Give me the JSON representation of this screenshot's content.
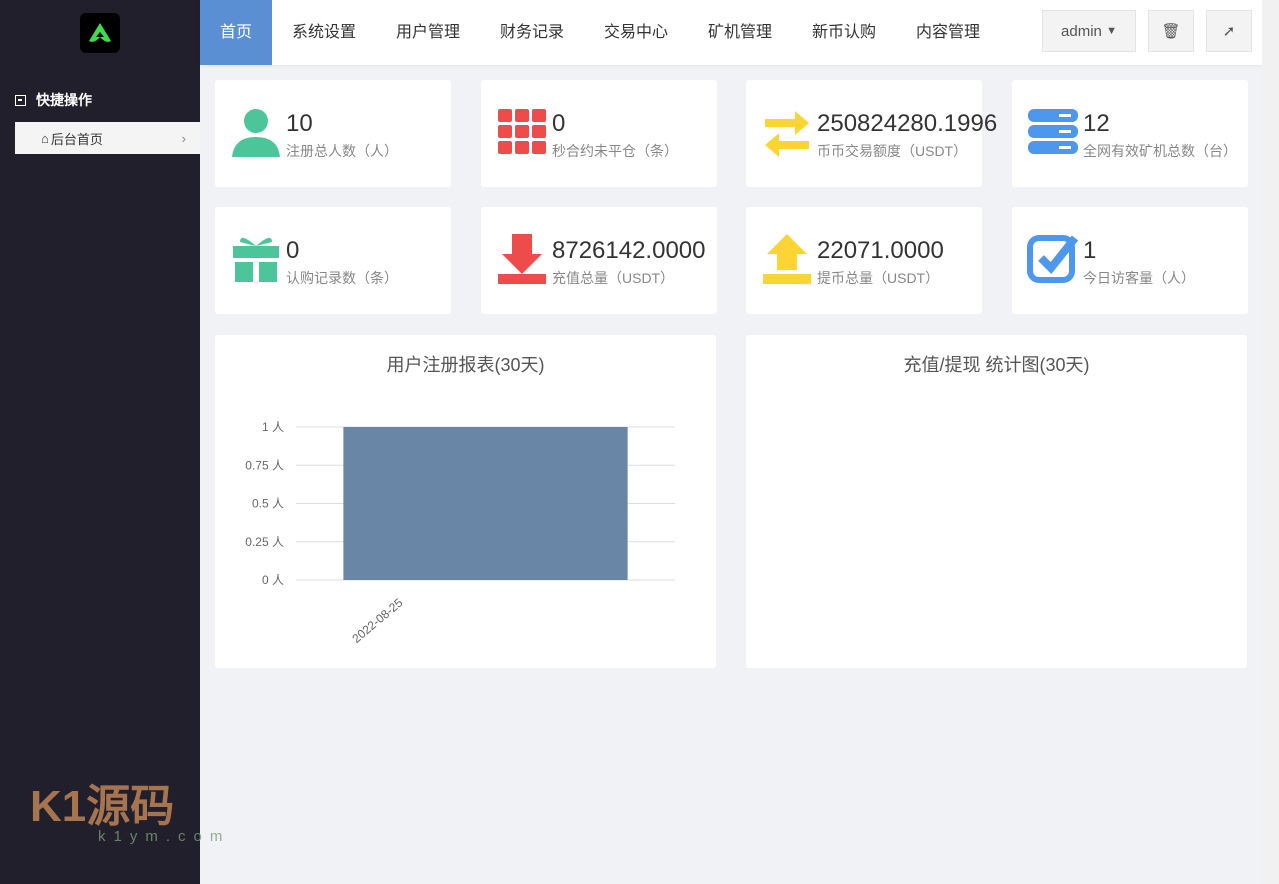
{
  "sidebar": {
    "section": "快捷操作",
    "item": "后台首页"
  },
  "watermark": {
    "brand": "K1源码",
    "url": "k1ym.com"
  },
  "tabs": [
    "首页",
    "系统设置",
    "用户管理",
    "财务记录",
    "交易中心",
    "矿机管理",
    "新币认购",
    "内容管理"
  ],
  "user": "admin",
  "stats": [
    {
      "value": "10",
      "label": "注册总人数（人）",
      "color": "#4cc59a",
      "icon": "user-icon"
    },
    {
      "value": "0",
      "label": "秒合约未平仓（条）",
      "color": "#ee4b4b",
      "icon": "grid-icon"
    },
    {
      "value": "250824280.1996",
      "label": "币币交易额度（USDT）",
      "color": "#fcd535",
      "icon": "exchange-icon"
    },
    {
      "value": "12",
      "label": "全网有效矿机总数（台）",
      "color": "#4d97ed",
      "icon": "server-icon"
    },
    {
      "value": "0",
      "label": "认购记录数（条）",
      "color": "#4cc59a",
      "icon": "gift-icon"
    },
    {
      "value": "8726142.0000",
      "label": "充值总量（USDT）",
      "color": "#ee4b4b",
      "icon": "download-icon"
    },
    {
      "value": "22071.0000",
      "label": "提币总量（USDT）",
      "color": "#fcd535",
      "icon": "upload-icon"
    },
    {
      "value": "1",
      "label": "今日访客量（人）",
      "color": "#4d97ed",
      "icon": "check-icon"
    }
  ],
  "chart_data": {
    "type": "bar",
    "title": "用户注册报表(30天)",
    "categories": [
      "2022-08-25"
    ],
    "values": [
      1
    ],
    "ylim": [
      0,
      1
    ],
    "yticks": [
      "0 人",
      "0.25 人",
      "0.5 人",
      "0.75 人",
      "1 人"
    ],
    "color": "#6a86a6"
  },
  "chart2": {
    "title": "充值/提现 统计图(30天)"
  }
}
